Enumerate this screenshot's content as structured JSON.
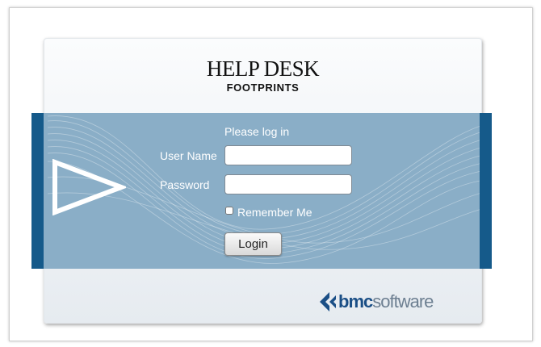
{
  "brand": {
    "title": "HELP DESK",
    "subtitle": "FOOTPRINTS"
  },
  "login": {
    "prompt": "Please log in",
    "username_label": "User Name",
    "username_value": "",
    "password_label": "Password",
    "password_value": "",
    "remember_label": "Remember Me",
    "remember_checked": false,
    "submit_label": "Login"
  },
  "vendor": {
    "logo_bold": "bmc",
    "logo_light": "software"
  },
  "colors": {
    "band": "#8aaec7",
    "band_edge": "#155a8a",
    "vendor_blue": "#1b4f86"
  },
  "icons": {
    "band_decoration": "play-triangle-icon",
    "vendor_mark": "bmc-chevron-icon"
  }
}
